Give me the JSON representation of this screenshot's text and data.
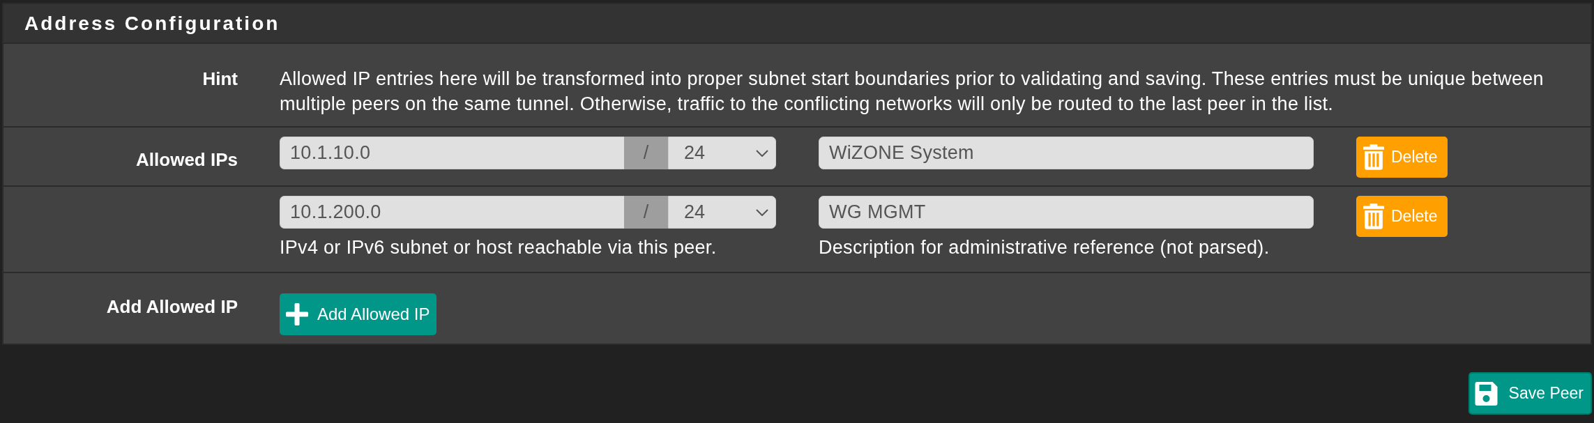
{
  "panel": {
    "title": "Address Configuration"
  },
  "hint": {
    "label": "Hint",
    "text": "Allowed IP entries here will be transformed into proper subnet start boundaries prior to validating and saving. These entries must be unique between multiple peers on the same tunnel. Otherwise, traffic to the conflicting networks will only be routed to the last peer in the list."
  },
  "allowed_ips": {
    "label": "Allowed IPs",
    "entries": [
      {
        "address": "10.1.10.0",
        "separator": "/",
        "prefix": "24",
        "description": "WiZONE System",
        "delete_label": "Delete"
      },
      {
        "address": "10.1.200.0",
        "separator": "/",
        "prefix": "24",
        "description": "WG MGMT",
        "delete_label": "Delete"
      }
    ],
    "address_help": "IPv4 or IPv6 subnet or host reachable via this peer.",
    "description_help": "Description for administrative reference (not parsed)."
  },
  "add_allowed_ip": {
    "label": "Add Allowed IP",
    "button": "Add Allowed IP"
  },
  "save_button": "Save Peer"
}
